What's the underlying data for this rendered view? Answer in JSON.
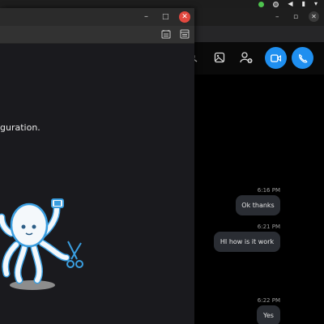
{
  "system_tray": {
    "icons": [
      "network-status-icon",
      "mixed-status-icon",
      "volume-icon",
      "notification-icon",
      "menu-chevron-icon"
    ]
  },
  "chat_window": {
    "controls": {
      "minimize": "–",
      "restore": "▫",
      "close": "✕"
    },
    "toolbar_icons": [
      "search-icon",
      "image-gallery-icon",
      "add-person-icon",
      "video-call-icon",
      "audio-call-icon"
    ],
    "accent_color": "#1f8ff0",
    "messages": [
      {
        "time": "6:16 PM",
        "text": "Ok thanks"
      },
      {
        "time": "6:21 PM",
        "text": "HI how is it work"
      },
      {
        "time": "6:22 PM",
        "text": "Yes"
      }
    ]
  },
  "main_window": {
    "controls": {
      "minimize": "–",
      "maximize": "□",
      "close": "✕"
    },
    "close_color": "#e2483f",
    "addressbar_icons": [
      "reader-mode-icon",
      "sidebar-icon"
    ],
    "body_text": "guration.",
    "illustration": "octopus-mascot-illustration"
  }
}
